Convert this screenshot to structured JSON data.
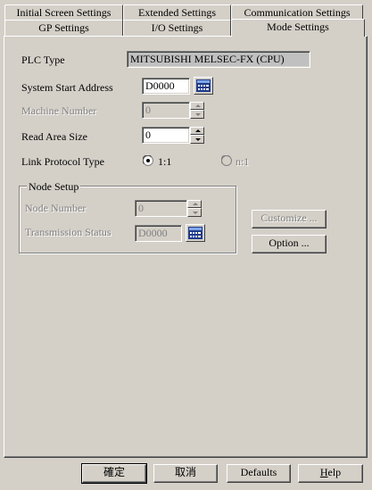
{
  "tabs": {
    "row_back": [
      "Initial Screen Settings",
      "Extended Settings",
      "Communication Settings"
    ],
    "row_front": [
      "GP Settings",
      "I/O Settings",
      "Mode Settings"
    ],
    "active": "Mode Settings"
  },
  "form": {
    "plc_type": {
      "label": "PLC Type",
      "value": "MITSUBISHI MELSEC-FX (CPU)"
    },
    "system_start_address": {
      "label": "System Start Address",
      "value": "D0000"
    },
    "machine_number": {
      "label": "Machine Number",
      "value": "0"
    },
    "read_area_size": {
      "label": "Read Area Size",
      "value": "0"
    },
    "link_protocol_type": {
      "label": "Link Protocol Type",
      "options": [
        "1:1",
        "n:1"
      ],
      "selected": "1:1"
    }
  },
  "node_setup": {
    "title": "Node Setup",
    "node_number": {
      "label": "Node Number",
      "value": "0"
    },
    "transmission_status": {
      "label": "Transmission Status",
      "value": "D0000"
    }
  },
  "side_buttons": {
    "customize": "Customize ...",
    "option": "Option ..."
  },
  "footer": {
    "ok": "確定",
    "cancel": "取消",
    "defaults": "Defaults",
    "help_underlined": "H",
    "help_rest": "elp"
  },
  "colors": {
    "face": "#d4d0c8",
    "shadow": "#808080",
    "highlight": "#ffffff",
    "readonly_field": "#c0c0c0"
  }
}
